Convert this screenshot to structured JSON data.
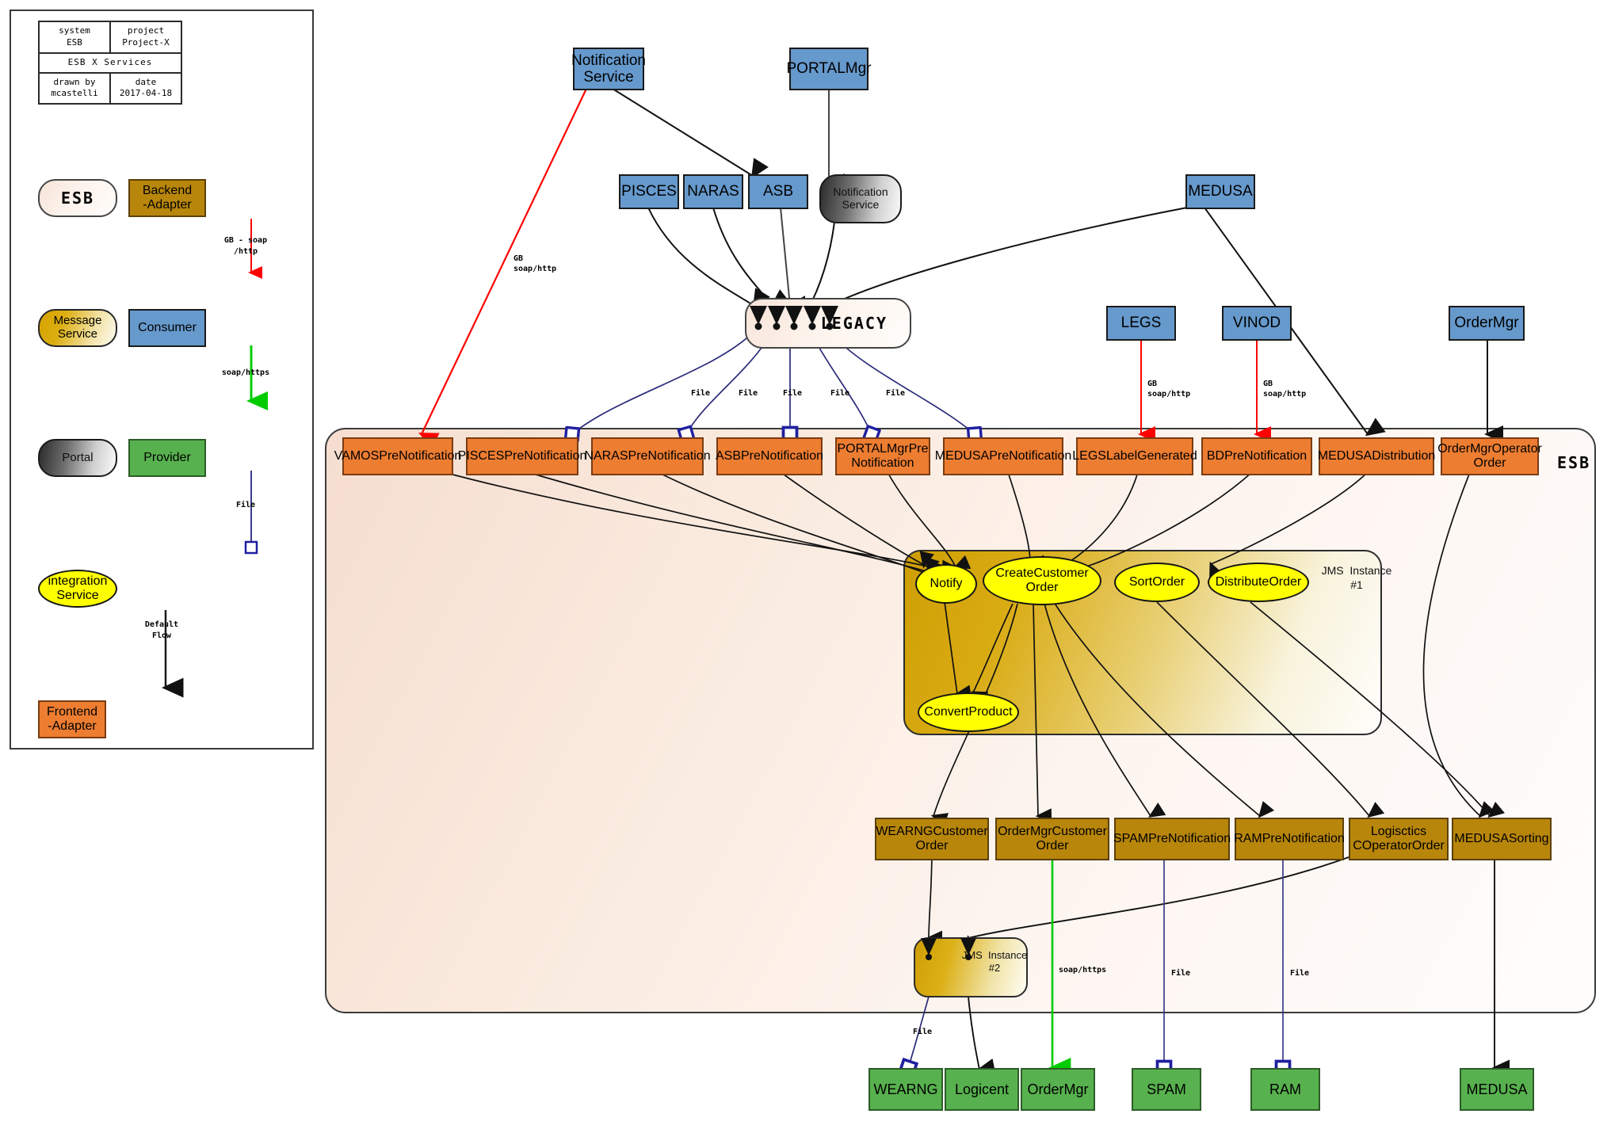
{
  "title_block": {
    "system_key": "system",
    "system_value": "ESB",
    "project_key": "project",
    "project_value": "Project-X",
    "diagram_title": "ESB X Services",
    "drawn_by_key": "drawn by",
    "drawn_by_value": "mcastelli",
    "date_key": "date",
    "date_value": "2017-04-18"
  },
  "legend": {
    "esb": "ESB",
    "backend_adapter": "Backend\n-Adapter",
    "message_service": "Message\nService",
    "consumer": "Consumer",
    "portal": "Portal",
    "provider": "Provider",
    "integration_service": "integration\nService",
    "frontend_adapter": "Frontend\n-Adapter",
    "arrow_gb_soap_http": "GB - soap\n/http",
    "arrow_soap_https": "soap/https",
    "arrow_file": "File",
    "arrow_default_flow": "Default\nFlow"
  },
  "colors": {
    "consumer": "#6699cc",
    "provider": "#57b14e",
    "frontend_adapter": "#ed7d31",
    "backend_adapter": "#b8860b",
    "integration_service": "#ffff00",
    "flow_gb_soap_http": "#ff0000",
    "flow_soap_https": "#00cc00",
    "flow_file": "#3b3b8f",
    "flow_default": "#1a1a1a"
  },
  "esb": {
    "label": "ESB"
  },
  "jms": {
    "instance1": "JMS  Instance\n#1",
    "instance2": "JMS  Instance\n#2"
  },
  "consumers": [
    {
      "id": "notification-service",
      "label": "Notification\nService"
    },
    {
      "id": "portalmgr",
      "label": "PORTALMgr"
    },
    {
      "id": "pisces",
      "label": "PISCES"
    },
    {
      "id": "naras",
      "label": "NARAS"
    },
    {
      "id": "asb",
      "label": "ASB"
    },
    {
      "id": "medusa",
      "label": "MEDUSA"
    },
    {
      "id": "legs",
      "label": "LEGS"
    },
    {
      "id": "vinod",
      "label": "VINOD"
    },
    {
      "id": "ordermgr",
      "label": "OrderMgr"
    }
  ],
  "portals": [
    {
      "id": "portal-notification-service",
      "label": "Notification\nService"
    },
    {
      "id": "portal-legacy",
      "label": "LEGACY"
    }
  ],
  "frontend_adapters": [
    {
      "id": "vamosprenotification",
      "label": "VAMOSPreNotification"
    },
    {
      "id": "piscesprenotification",
      "label": "PISCESPreNotification"
    },
    {
      "id": "narasprenotification",
      "label": "NARASPreNotification"
    },
    {
      "id": "asbprenotification",
      "label": "ASBPreNotification"
    },
    {
      "id": "portalmgrprenotification",
      "label": "PORTALMgrPre\nNotification"
    },
    {
      "id": "medusaprenotification",
      "label": "MEDUSAPreNotification"
    },
    {
      "id": "legslabelgenerated",
      "label": "LEGSLabelGenerated"
    },
    {
      "id": "bdprenotification",
      "label": "BDPreNotification"
    },
    {
      "id": "medusadistribution",
      "label": "MEDUSADistribution"
    },
    {
      "id": "ordermgroperatororder",
      "label": "OrderMgrOperator\nOrder"
    }
  ],
  "integration_services": [
    {
      "id": "notify",
      "label": "Notify"
    },
    {
      "id": "createcustomerorder",
      "label": "CreateCustomer\nOrder"
    },
    {
      "id": "sortorder",
      "label": "SortOrder"
    },
    {
      "id": "distributeorder",
      "label": "DistributeOrder"
    },
    {
      "id": "convertproduct",
      "label": "ConvertProduct"
    }
  ],
  "backend_adapters": [
    {
      "id": "wearngcustomerorder",
      "label": "WEARNGCustomer\nOrder"
    },
    {
      "id": "ordermgrcustomerorder",
      "label": "OrderMgrCustomer\nOrder"
    },
    {
      "id": "spamprenotification",
      "label": "SPAMPreNotification"
    },
    {
      "id": "ramprenotification",
      "label": "RAMPreNotification"
    },
    {
      "id": "logiscticscoperatororder",
      "label": "Logisctics\nCOperatorOrder"
    },
    {
      "id": "medusasorting",
      "label": "MEDUSASorting"
    }
  ],
  "providers": [
    {
      "id": "wearng",
      "label": "WEARNG"
    },
    {
      "id": "logicent",
      "label": "Logicent"
    },
    {
      "id": "provider-ordermgr",
      "label": "OrderMgr"
    },
    {
      "id": "spam",
      "label": "SPAM"
    },
    {
      "id": "ram",
      "label": "RAM"
    },
    {
      "id": "provider-medusa",
      "label": "MEDUSA"
    }
  ],
  "edge_labels": [
    {
      "id": "edge-label-vamos",
      "text": "GB\nsoap/http"
    },
    {
      "id": "edge-label-legacy-file-1",
      "text": "File"
    },
    {
      "id": "edge-label-legacy-file-2",
      "text": "File"
    },
    {
      "id": "edge-label-legacy-file-3",
      "text": "File"
    },
    {
      "id": "edge-label-legacy-file-4",
      "text": "File"
    },
    {
      "id": "edge-label-legacy-file-5",
      "text": "File"
    },
    {
      "id": "edge-label-legs",
      "text": "GB\nsoap/http"
    },
    {
      "id": "edge-label-vinod",
      "text": "GB\nsoap/http"
    },
    {
      "id": "edge-label-ordermgr-soap",
      "text": "soap/https"
    },
    {
      "id": "edge-label-spam-file",
      "text": "File"
    },
    {
      "id": "edge-label-ram-file",
      "text": "File"
    },
    {
      "id": "edge-label-wearng-file",
      "text": "File"
    }
  ]
}
